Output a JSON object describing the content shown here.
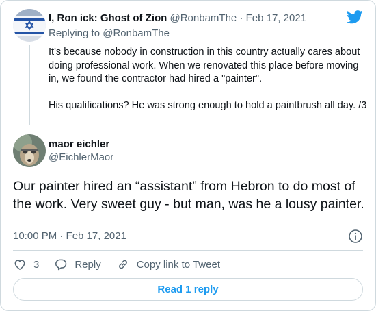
{
  "parent_tweet": {
    "author_name": "I, Ron ick: Ghost of Zion",
    "handle": "@RonbamThe",
    "separator": "·",
    "date": "Feb 17, 2021",
    "replying_label": "Replying to",
    "replying_handle": "@RonbamThe",
    "text_paragraph_1": "It's because nobody in construction in this country actually cares about doing professional work. When we renovated this place before moving in, we found the contractor had hired a \"painter\".",
    "text_paragraph_2": "His qualifications? He was strong enough to hold a paintbrush all day. /3"
  },
  "main_tweet": {
    "author_name": "maor eichler",
    "handle": "@EichlerMaor",
    "text": "Our painter hired an “assistant” from Hebron to do most of the work. Very sweet guy - but man, was he a lousy painter.",
    "timestamp": "10:00 PM · Feb 17, 2021"
  },
  "actions": {
    "like_count": "3",
    "reply_label": "Reply",
    "copy_link_label": "Copy link to Tweet"
  },
  "read_replies_label": "Read 1 reply",
  "icons": {
    "brand": "twitter-bird-icon",
    "info": "info-icon",
    "like": "heart-icon",
    "reply": "speech-bubble-icon",
    "copy_link": "link-icon"
  },
  "colors": {
    "brand": "#1d9bf0",
    "text": "#0f1419",
    "muted": "#536471",
    "border": "#cfd9de"
  }
}
